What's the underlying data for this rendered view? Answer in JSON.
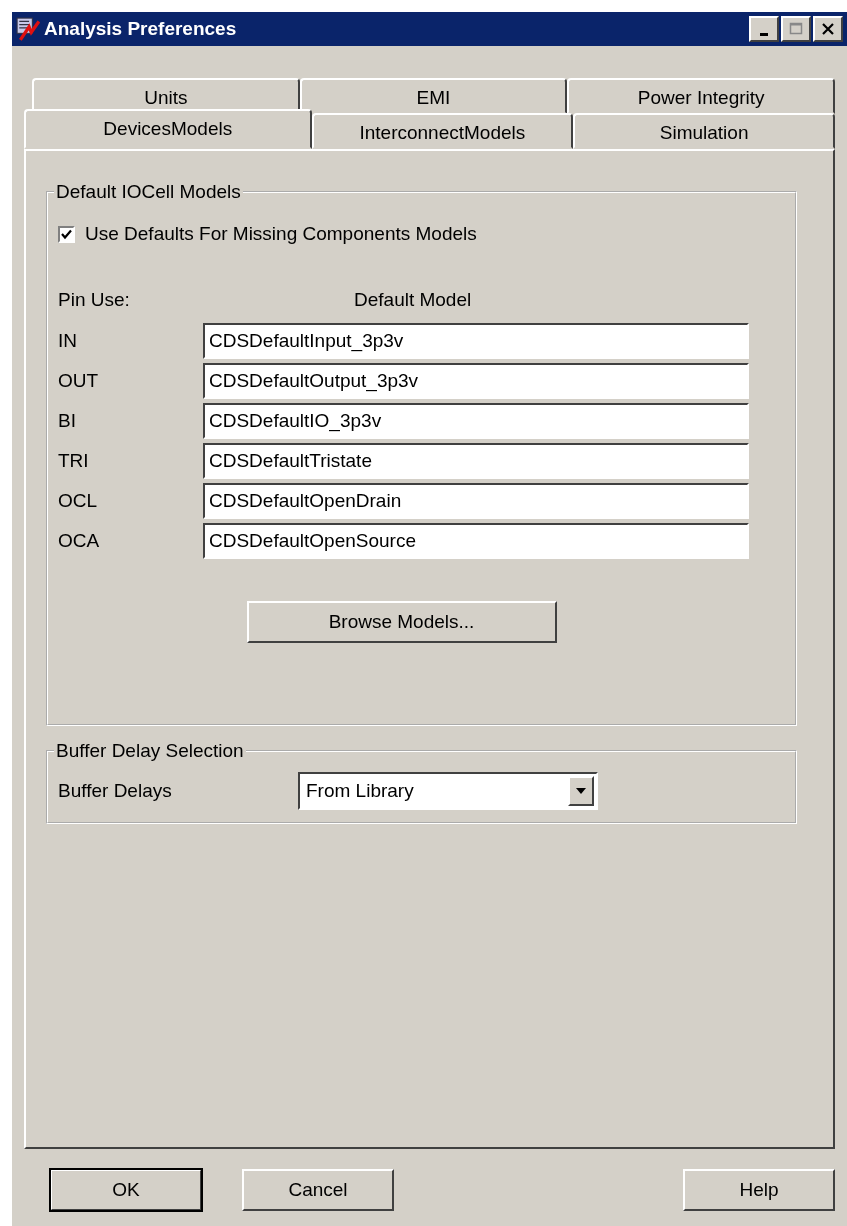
{
  "window": {
    "title": "Analysis Preferences"
  },
  "tab_rows": [
    [
      {
        "label": "Units",
        "selected": false
      },
      {
        "label": "EMI",
        "selected": false
      },
      {
        "label": "Power Integrity",
        "selected": false
      }
    ],
    [
      {
        "label": "DevicesModels",
        "selected": true
      },
      {
        "label": "InterconnectModels",
        "selected": false
      },
      {
        "label": "Simulation",
        "selected": false
      }
    ]
  ],
  "io_group": {
    "title": "Default IOCell Models",
    "use_defaults": {
      "label": "Use Defaults For Missing Components Models",
      "checked": true
    },
    "pin_use_header": "Pin Use:",
    "model_header": "Default Model",
    "rows": [
      {
        "pin": "IN",
        "model": "CDSDefaultInput_3p3v"
      },
      {
        "pin": "OUT",
        "model": "CDSDefaultOutput_3p3v"
      },
      {
        "pin": "BI",
        "model": "CDSDefaultIO_3p3v"
      },
      {
        "pin": "TRI",
        "model": "CDSDefaultTristate"
      },
      {
        "pin": "OCL",
        "model": "CDSDefaultOpenDrain"
      },
      {
        "pin": "OCA",
        "model": "CDSDefaultOpenSource"
      }
    ],
    "browse_button": "Browse Models..."
  },
  "buffer_group": {
    "title": "Buffer Delay Selection",
    "label": "Buffer Delays",
    "value": "From Library"
  },
  "buttons": [
    {
      "label": "OK",
      "default": true
    },
    {
      "label": "Cancel",
      "default": false
    },
    {
      "label": "Help",
      "default": false
    }
  ]
}
